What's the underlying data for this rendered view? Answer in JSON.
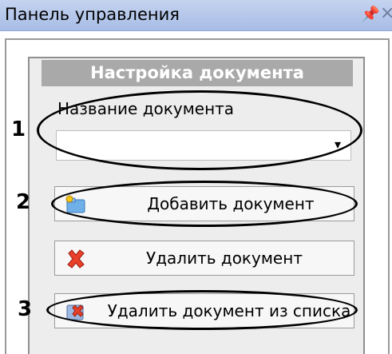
{
  "window": {
    "title": "Панель управления",
    "pin_glyph": "⍑",
    "close_glyph": "×"
  },
  "group": {
    "header": "Настройка документа",
    "field_label": "Название документа",
    "combo_value": "",
    "combo_arrow": "▾"
  },
  "buttons": {
    "add": {
      "label": "Добавить документ",
      "icon": "folder-add-icon"
    },
    "delete": {
      "label": "Удалить документ",
      "icon": "red-x-icon"
    },
    "delete_from_list": {
      "label": "Удалить документ из списка",
      "icon": "remove-from-list-icon"
    }
  },
  "callouts": [
    "1",
    "2",
    "3"
  ],
  "colors": {
    "titlebar": "#b7c9ec",
    "group_header": "#a9a9a9",
    "group_bg": "#ededed"
  }
}
